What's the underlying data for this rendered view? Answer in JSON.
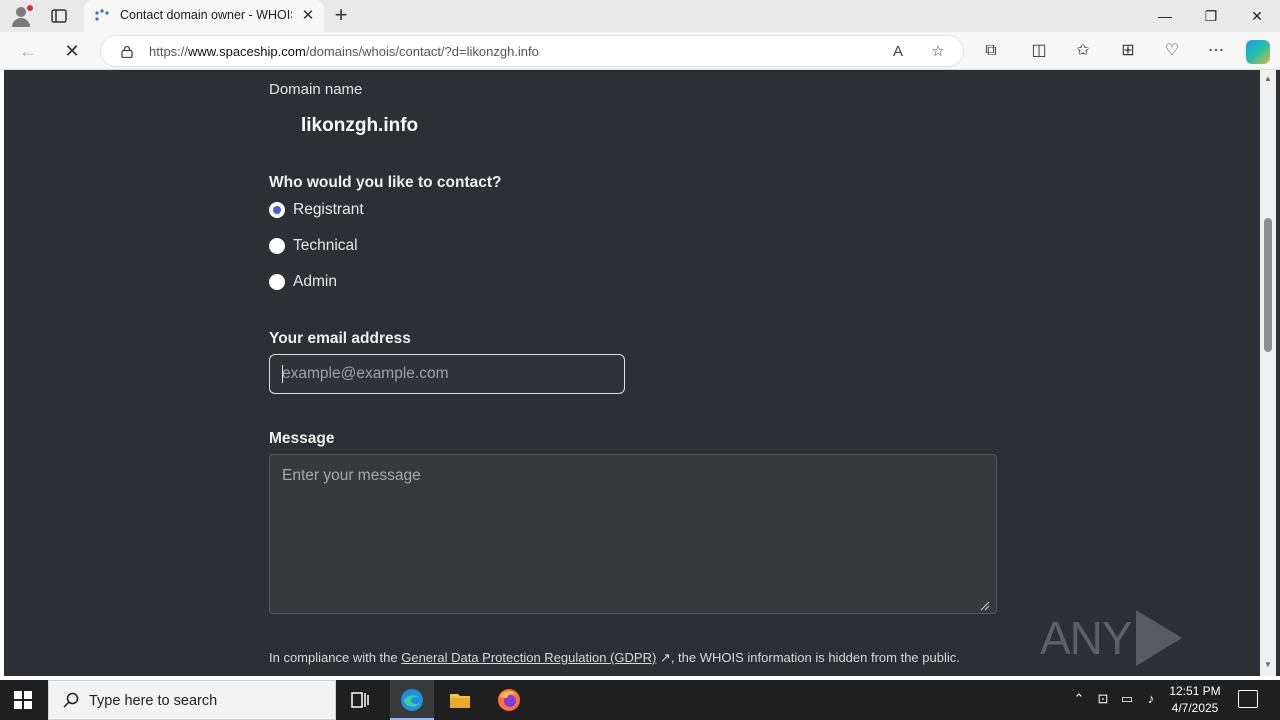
{
  "browser": {
    "tab_title": "Contact domain owner - WHOIS",
    "tab_close": "✕",
    "new_tab": "+",
    "url_prefix": "https://",
    "url_host": "www.spaceship.com",
    "url_path": "/domains/whois/contact/?d=likonzgh.info",
    "back": "←",
    "stop": "✕",
    "min": "—",
    "restore": "❐",
    "close": "✕"
  },
  "form": {
    "domain_label": "Domain name",
    "domain_value": "likonzgh.info",
    "contact_question": "Who would you like to contact?",
    "options": [
      {
        "label": "Registrant",
        "checked": true
      },
      {
        "label": "Technical",
        "checked": false
      },
      {
        "label": "Admin",
        "checked": false
      }
    ],
    "email_label": "Your email address",
    "email_placeholder": "example@example.com",
    "message_label": "Message",
    "message_placeholder": "Enter your message",
    "gdpr_prefix": "In compliance with the ",
    "gdpr_link": "General Data Protection Regulation (GDPR)",
    "gdpr_arrow": "↗",
    "gdpr_suffix": ", the WHOIS information is hidden from the public."
  },
  "watermark": {
    "left": "ANY",
    "right": "RUN"
  },
  "taskbar": {
    "search_placeholder": "Type here to search",
    "time": "12:51 PM",
    "date": "4/7/2025"
  },
  "icons": [
    "profile-icon",
    "tabs-icon",
    "favicon-icon",
    "lock-icon",
    "read-aloud-icon",
    "favorite-star-icon",
    "extensions-icon",
    "split-screen-icon",
    "favorites-icon",
    "collections-icon",
    "performance-icon",
    "more-icon",
    "copilot-icon",
    "windows-start-icon",
    "search-icon",
    "task-view-icon",
    "edge-icon",
    "file-explorer-icon",
    "firefox-icon"
  ],
  "colors": {
    "page_bg": "#2c2f33",
    "radio_accent": "#4a5bdc"
  }
}
